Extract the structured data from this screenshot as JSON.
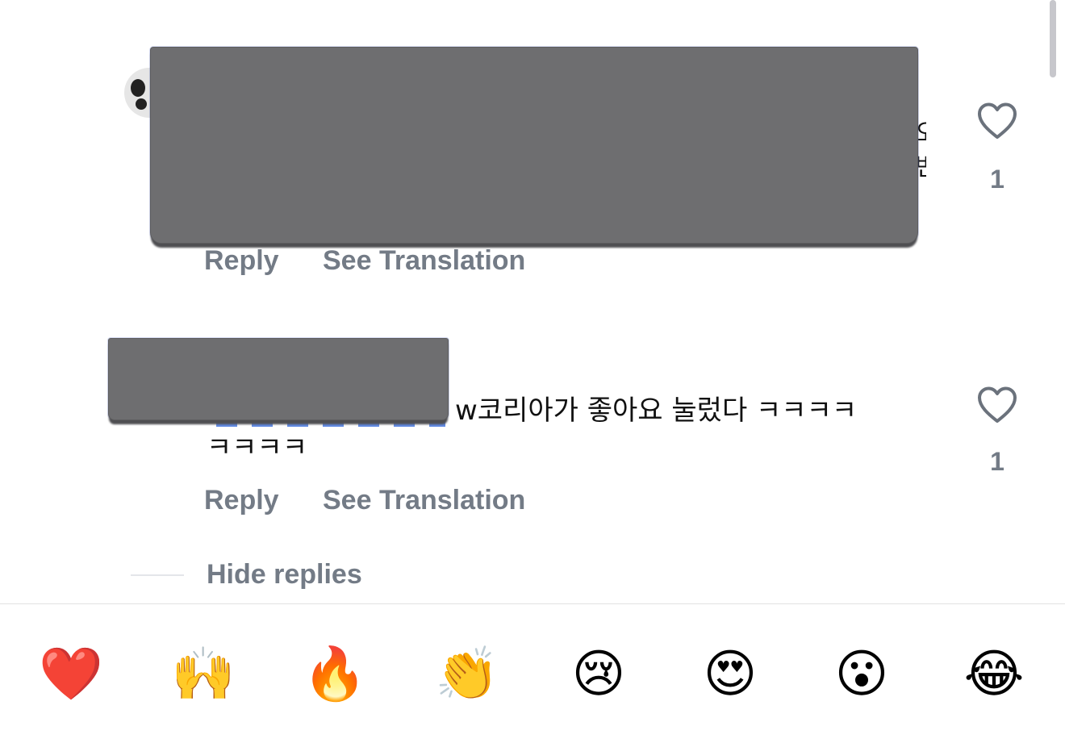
{
  "comments": [
    {
      "text_line1": "",
      "text_line2": "",
      "edge_char_1": "오",
      "edge_char_2": "변",
      "reply_label": "Reply",
      "translate_label": "See Translation",
      "like_count": "1"
    },
    {
      "text_line1": "w코리아가 좋아요 눌렀다 ㅋㅋㅋㅋ",
      "text_line2": "ㅋㅋㅋㅋ",
      "reply_label": "Reply",
      "translate_label": "See Translation",
      "like_count": "1"
    }
  ],
  "hide_replies_label": "Hide replies",
  "reactions": [
    {
      "name": "red-heart",
      "glyph": "❤️"
    },
    {
      "name": "raising-hands",
      "glyph": "🙌"
    },
    {
      "name": "fire",
      "glyph": "🔥"
    },
    {
      "name": "clapping-hands",
      "glyph": "👏"
    },
    {
      "name": "crying-face",
      "glyph": "😢"
    },
    {
      "name": "heart-eyes",
      "glyph": "😍"
    },
    {
      "name": "surprised-face",
      "glyph": "😮"
    },
    {
      "name": "tears-of-joy",
      "glyph": "😂"
    }
  ],
  "icons": {
    "like": "heart-outline-icon"
  },
  "colors": {
    "muted_text": "#737b86",
    "redaction": "#6e6e70",
    "heart_stroke": "#6b727c"
  }
}
